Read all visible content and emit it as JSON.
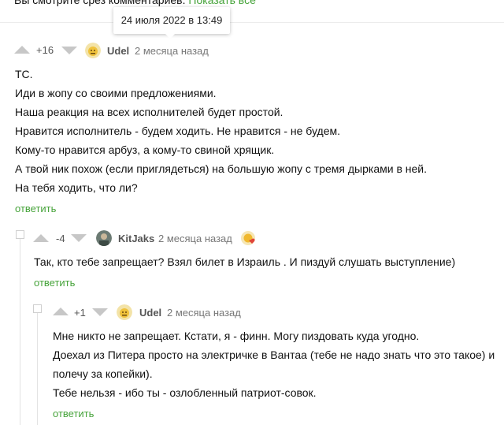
{
  "top": {
    "text": "Вы смотрите срез комментариев.",
    "link": "Показать все"
  },
  "tooltip": "24 июля 2022 в 13:49",
  "comments": [
    {
      "rating": "+16",
      "user": "Udel",
      "time": "2 месяца назад",
      "lines": [
        "ТС.",
        "Иди в жопу со своими предложениями.",
        "Наша реакция на всех исполнителей будет простой.",
        "Нравится исполнитель - будем ходить. Не нравится - не будем.",
        "Кому-то нравится арбуз, а кому-то свиной хрящик.",
        "А твой ник похож (если приглядеться) на большую жопу с тремя дырками в ней.",
        "На тебя ходить, что ли?"
      ],
      "reply": "ответить"
    },
    {
      "rating": "-4",
      "user": "KitJaks",
      "time": "2 месяца назад",
      "lines": [
        "Так, кто тебе запрещает? Взял билет в Израиль . И пиздуй слушать выступление)"
      ],
      "reply": "ответить"
    },
    {
      "rating": "+1",
      "user": "Udel",
      "time": "2 месяца назад",
      "lines": [
        "Мне никто не запрещает. Кстати, я - финн. Могу пиздовать куда угодно.",
        "Доехал из Питера просто на электричке в Вантаа (тебе не надо знать что это такое) и",
        "полечу за копейки).",
        "Тебе нельзя - ибо ты - озлобленный патриот-совок."
      ],
      "reply": "ответить"
    }
  ]
}
